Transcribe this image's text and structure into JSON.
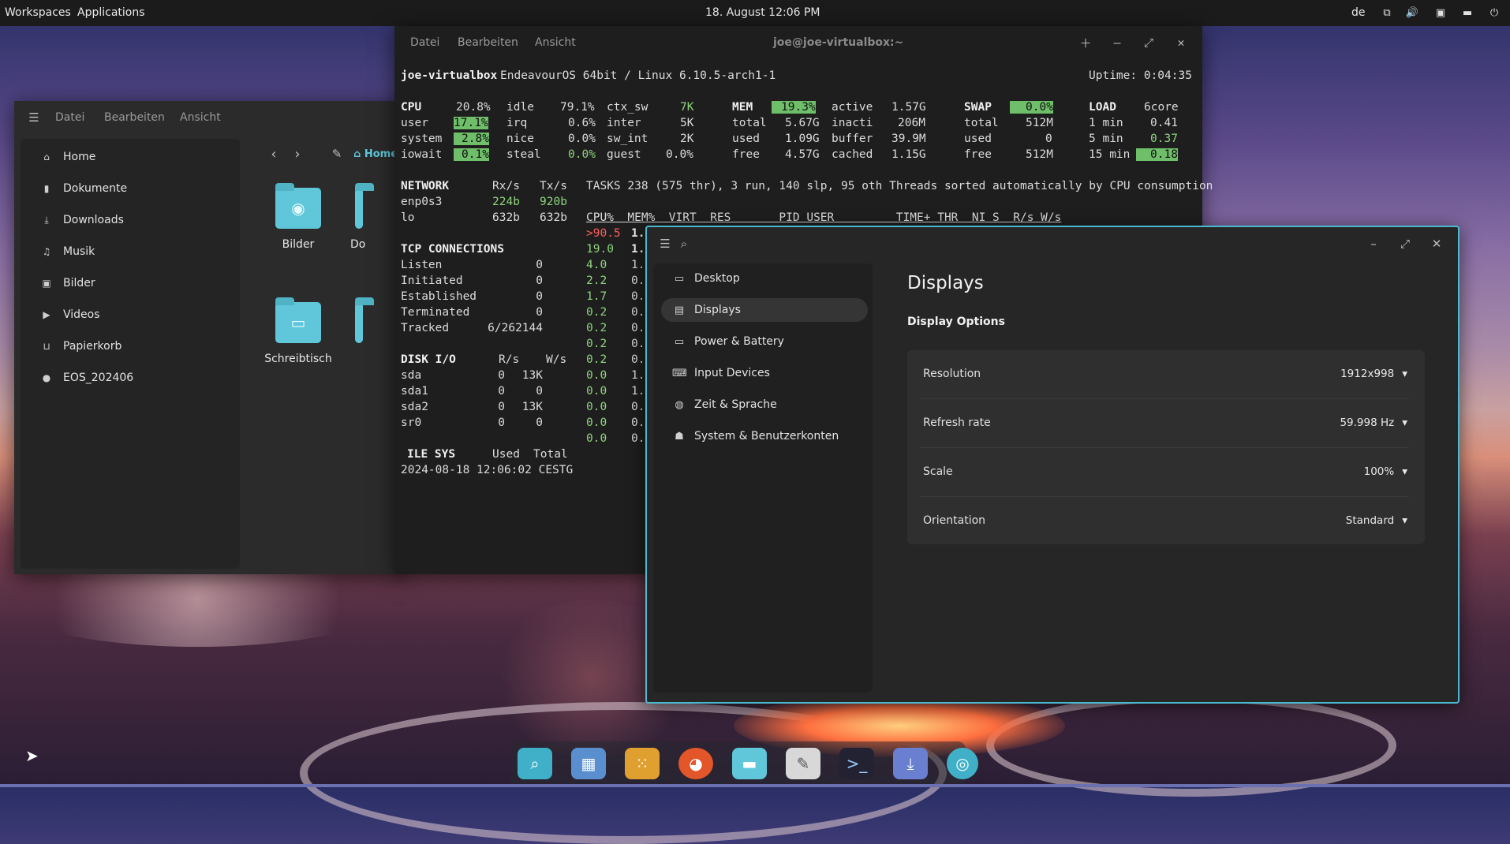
{
  "topbar": {
    "workspaces": "Workspaces",
    "applications": "Applications",
    "datetime": "18. August 12:06 PM",
    "keyboard_layout": "de"
  },
  "files": {
    "menu": [
      "Datei",
      "Bearbeiten",
      "Ansicht"
    ],
    "path": "Home",
    "sidebar": [
      {
        "label": "Home",
        "icon": "home-icon"
      },
      {
        "label": "Dokumente",
        "icon": "document-icon"
      },
      {
        "label": "Downloads",
        "icon": "download-icon"
      },
      {
        "label": "Musik",
        "icon": "music-icon"
      },
      {
        "label": "Bilder",
        "icon": "picture-icon"
      },
      {
        "label": "Videos",
        "icon": "video-icon"
      },
      {
        "label": "Papierkorb",
        "icon": "trash-icon"
      },
      {
        "label": "EOS_202406",
        "icon": "disc-icon"
      }
    ],
    "folders": [
      "Bilder",
      "Do",
      "Schreibtisch"
    ]
  },
  "terminal": {
    "menu": [
      "Datei",
      "Bearbeiten",
      "Ansicht"
    ],
    "title": "joe@joe-virtualbox:~",
    "host": "joe-virtualbox",
    "os": "EndeavourOS 64bit / Linux 6.10.5-arch1-1",
    "uptime": "Uptime: 0:04:35",
    "cpu": {
      "total": "20.8%",
      "user": "17.1%",
      "system": "2.8%",
      "iowait": "0.1%",
      "idle": "79.1%",
      "irq": "0.6%",
      "nice": "0.0%",
      "steal": "0.0%",
      "ctx_sw": "7K",
      "inter": "5K",
      "sw_int": "2K",
      "guest": "0.0%"
    },
    "mem": {
      "percent": "19.3%",
      "total": "5.67G",
      "used": "1.09G",
      "free": "4.57G",
      "active": "1.57G",
      "inacti": "206M",
      "buffer": "39.9M",
      "cached": "1.15G"
    },
    "swap": {
      "percent": "0.0%",
      "total": "512M",
      "used": "0",
      "free": "512M"
    },
    "load": {
      "cores": "6core",
      "min1": "0.41",
      "min5": "0.37",
      "min15": "0.18"
    },
    "network": [
      {
        "iface": "enp0s3",
        "rx": "224b",
        "tx": "920b"
      },
      {
        "iface": "lo",
        "rx": "632b",
        "tx": "632b"
      }
    ],
    "tasks": "TASKS 238 (575 thr), 3 run, 140 slp, 95 oth Threads sorted automatically by CPU consumption",
    "proc_header": "CPU%  MEM%  VIRT  RES       PID USER         TIME+ THR  NI S  R/s W/s",
    "proc_cpu": [
      ">90.5",
      "19.0",
      "4.0",
      "2.2",
      "1.7",
      "0.2",
      "0.2",
      "0.2",
      "0.2",
      "0.0",
      "0.0",
      "0.0",
      "0.0",
      "0.0"
    ],
    "proc_mem": [
      "1.",
      "1.",
      "1.",
      "0.",
      "0.",
      "0.",
      "0.",
      "0.",
      "0.",
      "1.",
      "1.",
      "0.",
      "0.",
      "0."
    ],
    "tcp": [
      {
        "k": "Listen",
        "v": "0"
      },
      {
        "k": "Initiated",
        "v": "0"
      },
      {
        "k": "Established",
        "v": "0"
      },
      {
        "k": "Terminated",
        "v": "0"
      },
      {
        "k": "Tracked",
        "v": "6/262144"
      }
    ],
    "disk": [
      {
        "dev": "sda",
        "r": "0",
        "w": "13K"
      },
      {
        "dev": "sda1",
        "r": "0",
        "w": "0"
      },
      {
        "dev": "sda2",
        "r": "0",
        "w": "13K"
      },
      {
        "dev": "sr0",
        "r": "0",
        "w": "0"
      }
    ],
    "filesys": {
      "label": "ILE SYS",
      "used": "Used",
      "total": "Total"
    },
    "timestamp": "2024-08-18 12:06:02 CESTG"
  },
  "settings": {
    "sidebar": [
      {
        "label": "Desktop",
        "icon": "monitor-icon"
      },
      {
        "label": "Displays",
        "icon": "display-icon"
      },
      {
        "label": "Power & Battery",
        "icon": "battery-icon"
      },
      {
        "label": "Input Devices",
        "icon": "keyboard-icon"
      },
      {
        "label": "Zeit & Sprache",
        "icon": "globe-icon"
      },
      {
        "label": "System & Benutzerkonten",
        "icon": "users-icon"
      }
    ],
    "page_title": "Displays",
    "section": "Display Options",
    "options": [
      {
        "label": "Resolution",
        "value": "1912x998"
      },
      {
        "label": "Refresh rate",
        "value": "59.998 Hz"
      },
      {
        "label": "Scale",
        "value": "100%"
      },
      {
        "label": "Orientation",
        "value": "Standard"
      }
    ]
  },
  "dock": [
    "launcher-icon",
    "multitasking-icon",
    "app-grid-icon",
    "firefox-icon",
    "files-icon",
    "text-editor-icon",
    "terminal-icon",
    "installer-icon",
    "settings-icon"
  ],
  "colors": {
    "accent": "#4cb8cf",
    "highlight": "#6fbf6a",
    "folder": "#5fc7d9"
  }
}
